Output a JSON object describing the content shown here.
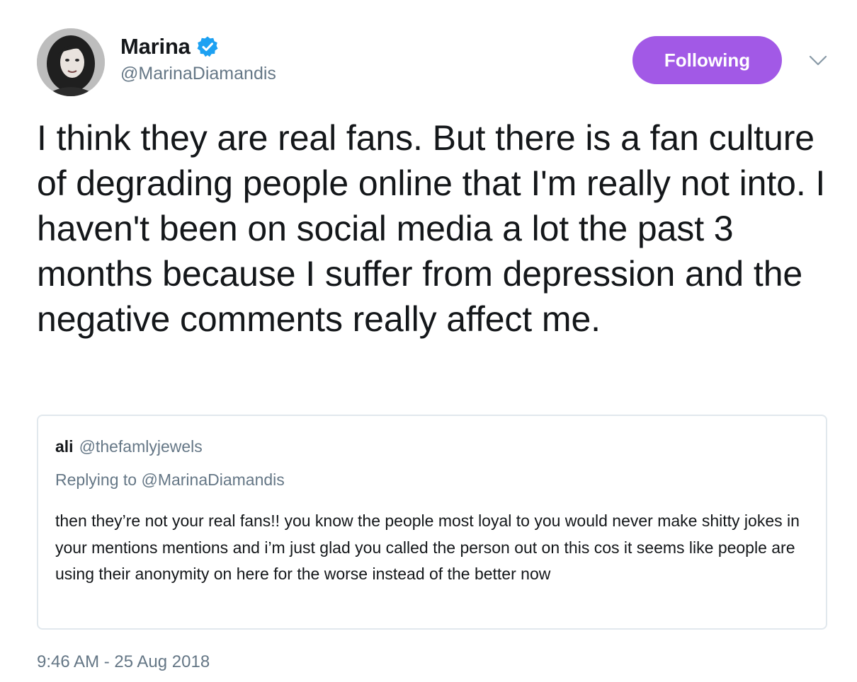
{
  "author": {
    "display_name": "Marina",
    "handle": "@MarinaDiamandis",
    "verified": true,
    "avatar_icon": "profile-photo"
  },
  "follow_button": {
    "label": "Following",
    "color": "#a259e6"
  },
  "menu": {
    "icon": "chevron-down-icon"
  },
  "tweet": {
    "text": "I think they are real fans. But there is a fan culture of degrading people online that I'm really not into. I haven't been on social media a lot the past 3 months because I suffer from depression and the negative comments really affect me.",
    "timestamp": "9:46 AM - 25 Aug 2018"
  },
  "quoted_tweet": {
    "display_name": "ali",
    "handle": "@thefamlyjewels",
    "replying_prefix": "Replying to",
    "replying_to": "@MarinaDiamandis",
    "text": "then they’re not your real fans!! you know the people most loyal to you would never make shitty jokes in your mentions mentions and i’m just glad you called the person out on this cos it seems like people are using their anonymity on here for the worse instead of the better now"
  },
  "colors": {
    "primary_text": "#14171a",
    "secondary_text": "#657786",
    "verified_blue": "#1da1f2",
    "border": "#e1e8ed"
  }
}
